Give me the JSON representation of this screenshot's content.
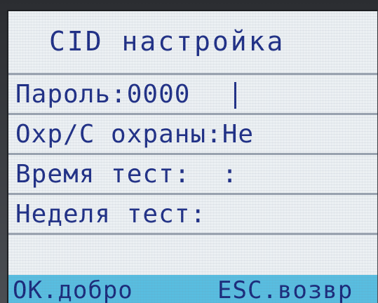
{
  "screen": {
    "title": "CID настройка",
    "rows": [
      {
        "text": "Пароль:0000"
      },
      {
        "text": "Охр/С охраны:Не"
      },
      {
        "text": "Время тест:  :"
      },
      {
        "text": "Неделя тест:"
      },
      {
        "text": ""
      }
    ],
    "footer": {
      "ok_label": "OK.добро",
      "esc_label": "ESC.возвр"
    }
  },
  "colors": {
    "lcd_background": "#ecf0f3",
    "lcd_text": "#1f2f86",
    "footer_bar": "#58bde0"
  }
}
